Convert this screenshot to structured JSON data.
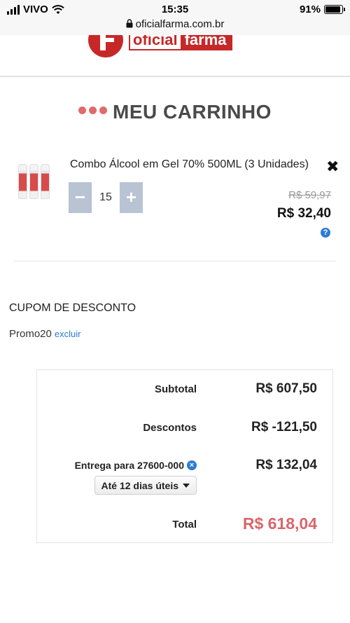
{
  "status_bar": {
    "carrier": "VIVO",
    "time": "15:35",
    "battery": "91%",
    "battery_level": 0.91
  },
  "browser": {
    "url": "oficialfarma.com.br"
  },
  "header": {
    "logo_text_1": "oficial",
    "logo_text_2": "farma"
  },
  "cart": {
    "title": "MEU CARRINHO",
    "items": [
      {
        "name": "Combo Álcool em Gel 70% 500ML (3 Unidades)",
        "quantity": "15",
        "old_price": "R$ 59,97",
        "price": "R$ 32,40",
        "decrement_label": "−",
        "increment_label": "+",
        "remove_label": "✖",
        "help_label": "?"
      }
    ]
  },
  "coupon": {
    "label": "CUPOM DE DESCONTO",
    "code": "Promo20",
    "remove_label": "excluir"
  },
  "summary": {
    "subtotal_label": "Subtotal",
    "subtotal_value": "R$ 607,50",
    "discount_label": "Descontos",
    "discount_value": "R$ -121,50",
    "shipping_label": "Entrega para 27600-000",
    "shipping_clear_label": "×",
    "shipping_value": "R$ 132,04",
    "shipping_option": "Até 12 dias úteis",
    "total_label": "Total",
    "total_value": "R$ 618,04"
  },
  "colors": {
    "brand_red": "#c62828",
    "accent_dots": "#e06b6b",
    "total_price": "#d9666a",
    "link_blue": "#2b7cd3",
    "qty_button": "#b8c3d3"
  }
}
